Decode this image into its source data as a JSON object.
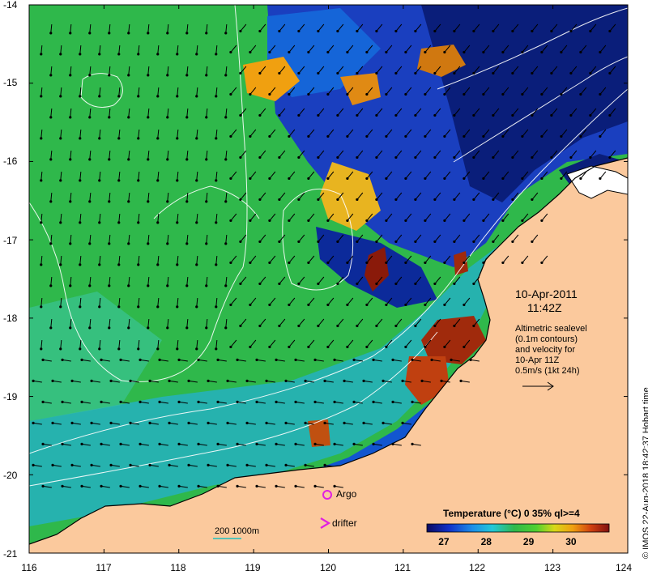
{
  "map": {
    "lat_ticks": [
      "-14",
      "-15",
      "-16",
      "-17",
      "-18",
      "-19",
      "-20",
      "-21"
    ],
    "lon_ticks": [
      "116",
      "117",
      "118",
      "119",
      "120",
      "121",
      "122",
      "123",
      "124"
    ],
    "lon_range": [
      116,
      124
    ],
    "lat_range": [
      -21,
      -14
    ],
    "colors": {
      "land": "#fbc99d",
      "cold": "#0a1e7a",
      "mid": "#2fb84b",
      "warm": "#e8b420",
      "hot": "#a02a0c"
    }
  },
  "annotation": {
    "date": "10-Apr-2011",
    "time": "11:42Z",
    "altimetry_lines": [
      "Altimetric sealevel",
      "(0.1m contours)",
      "and velocity for",
      "10-Apr 11Z",
      "0.5m/s (1kt 24h)"
    ]
  },
  "legend": {
    "argo": "Argo",
    "drifter": "drifter",
    "scale_label": "200  1000m",
    "colorbar_title": "Temperature (°C) 0 35% ql>=4",
    "colorbar_ticks": [
      "27",
      "28",
      "29",
      "30"
    ],
    "colorbar_range": [
      26.6,
      30.9
    ]
  },
  "credit": "© IMOS 22-Aug-2018 18:42:37 Hobart time"
}
